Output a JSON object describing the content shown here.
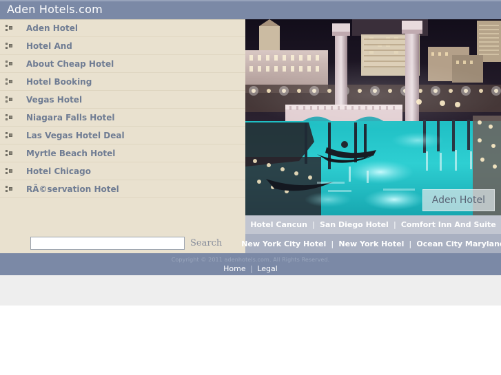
{
  "header": {
    "site_title": "Aden Hotels.com",
    "bar_color": "#7b89a6"
  },
  "sidebar": {
    "background_color": "#e9e1cf",
    "link_color": "#6f7c93",
    "bullet_icon": "square-cluster-bullet-icon",
    "items": [
      {
        "label": "Aden Hotel"
      },
      {
        "label": "Hotel And"
      },
      {
        "label": "About Cheap Hotel"
      },
      {
        "label": "Hotel Booking"
      },
      {
        "label": "Vegas Hotel"
      },
      {
        "label": "Niagara Falls Hotel"
      },
      {
        "label": "Las Vegas Hotel Deal"
      },
      {
        "label": "Myrtle Beach Hotel"
      },
      {
        "label": "Hotel Chicago"
      },
      {
        "label": "RÃ©servation Hotel"
      }
    ]
  },
  "search": {
    "value": "",
    "placeholder": "",
    "button_label": "Search"
  },
  "hero": {
    "image_alt": "night-view-of-venetian-hotel-canal-with-gondolas-las-vegas",
    "caption": "Aden Hotel"
  },
  "linkbars": [
    {
      "background_color": "#c2c6d1",
      "separator": "|",
      "links": [
        {
          "label": "Hotel Cancun"
        },
        {
          "label": "San Diego Hotel"
        },
        {
          "label": "Comfort Inn And Suite"
        }
      ]
    },
    {
      "background_color": "#a9b0c1",
      "separator": "|",
      "links": [
        {
          "label": "New York City Hotel"
        },
        {
          "label": "New York Hotel"
        },
        {
          "label": "Ocean City Maryland"
        }
      ]
    }
  ],
  "footer": {
    "copyright": "Copyright © 2011 adenhotels.com. All Rights Reserved.",
    "separator": "|",
    "links": [
      {
        "label": "Home"
      },
      {
        "label": "Legal"
      }
    ]
  }
}
